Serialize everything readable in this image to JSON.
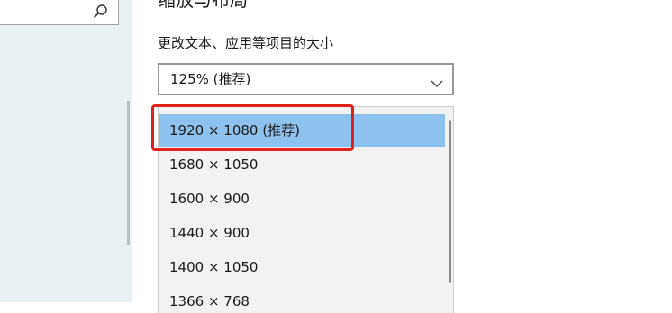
{
  "left_pane": {
    "search_icon": "search-icon"
  },
  "section": {
    "title": "缩放与布局",
    "scale_label": "更改文本、应用等项目的大小",
    "scale_value": "125% (推荐)"
  },
  "resolution_list": {
    "items": [
      {
        "label": "1920 × 1080 (推荐)",
        "selected": true
      },
      {
        "label": "1680 × 1050",
        "selected": false
      },
      {
        "label": "1600 × 900",
        "selected": false
      },
      {
        "label": "1440 × 900",
        "selected": false
      },
      {
        "label": "1400 × 1050",
        "selected": false
      },
      {
        "label": "1366 × 768",
        "selected": false
      }
    ]
  },
  "colors": {
    "selected_item": "#8dc1ef",
    "highlight_box": "#e0201b",
    "nav_background": "#e9f0f3"
  }
}
